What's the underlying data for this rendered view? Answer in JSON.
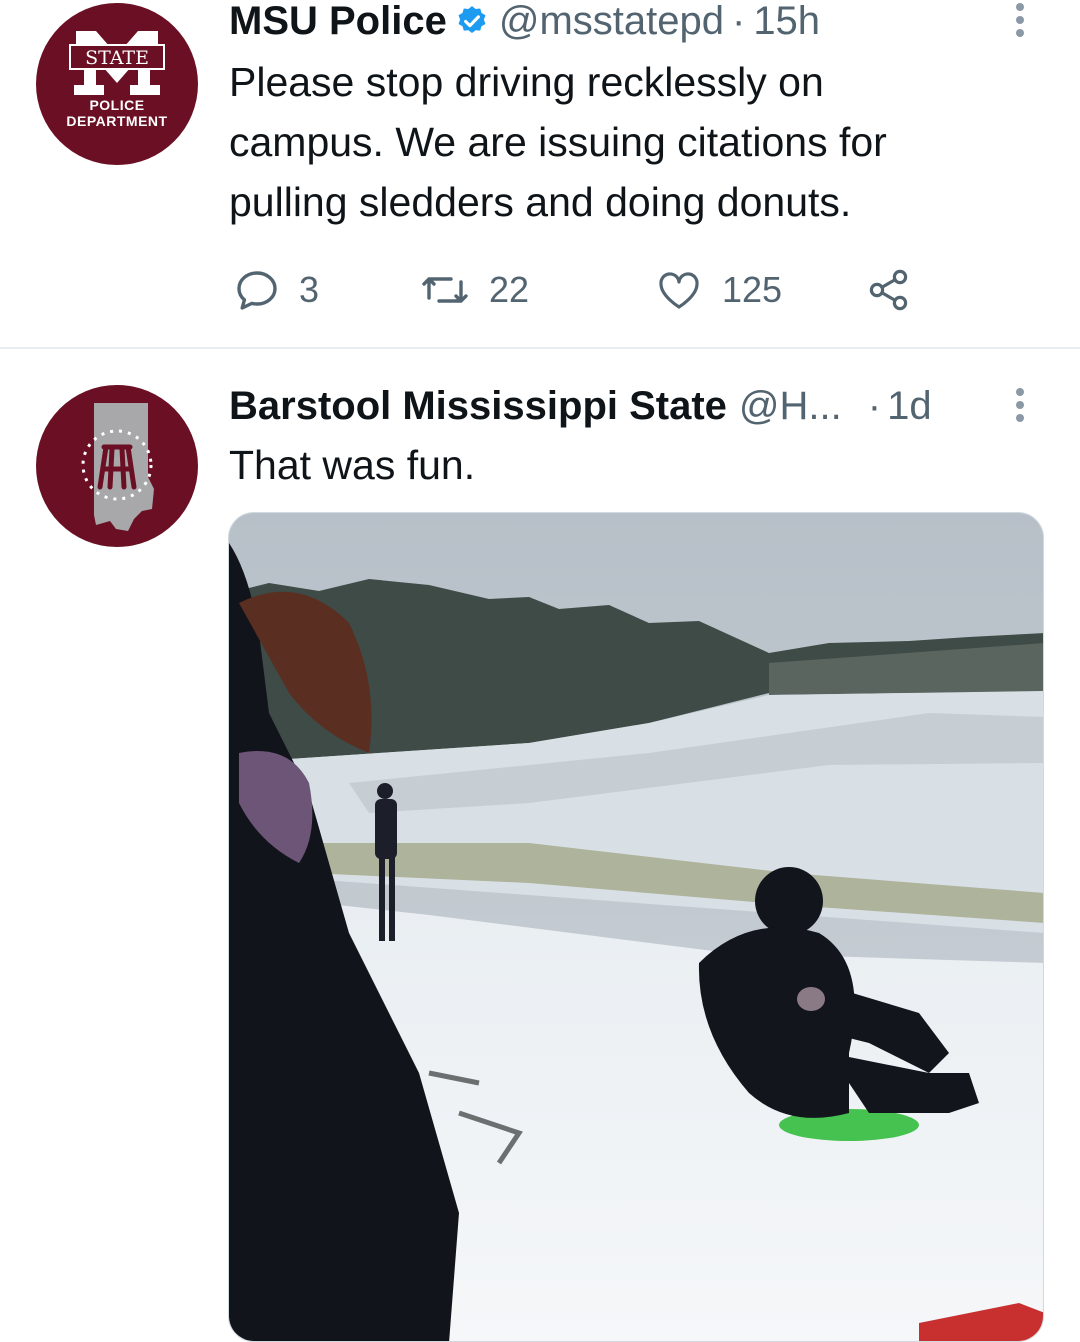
{
  "tweets": [
    {
      "author": {
        "name": "MSU Police",
        "handle": "@msstatepd",
        "verified": true
      },
      "avatar": {
        "top_text": "STATE",
        "line1": "POLICE",
        "line2": "DEPARTMENT",
        "color": "#6b1024"
      },
      "separator": "·",
      "time": "15h",
      "text": "Please stop driving recklessly on\ncampus.  We are issuing citations for\npulling sledders and doing donuts.",
      "stats": {
        "replies": "3",
        "retweets": "22",
        "likes": "125"
      }
    },
    {
      "author": {
        "name": "Barstool Mississippi State",
        "handle": "@H...",
        "verified": false
      },
      "avatar": {
        "color": "#6b1024"
      },
      "separator": "·",
      "time": "1d",
      "text": "That was fun.",
      "media": {
        "type": "photo"
      }
    }
  ],
  "colors": {
    "text": "#0f1419",
    "secondary": "#536471",
    "verified": "#1d9bf0",
    "maroon": "#6b1024",
    "divider": "#e6ecf0"
  },
  "icons": [
    "verified-badge-icon",
    "more-options-icon",
    "reply-icon",
    "retweet-icon",
    "like-icon",
    "share-icon"
  ]
}
